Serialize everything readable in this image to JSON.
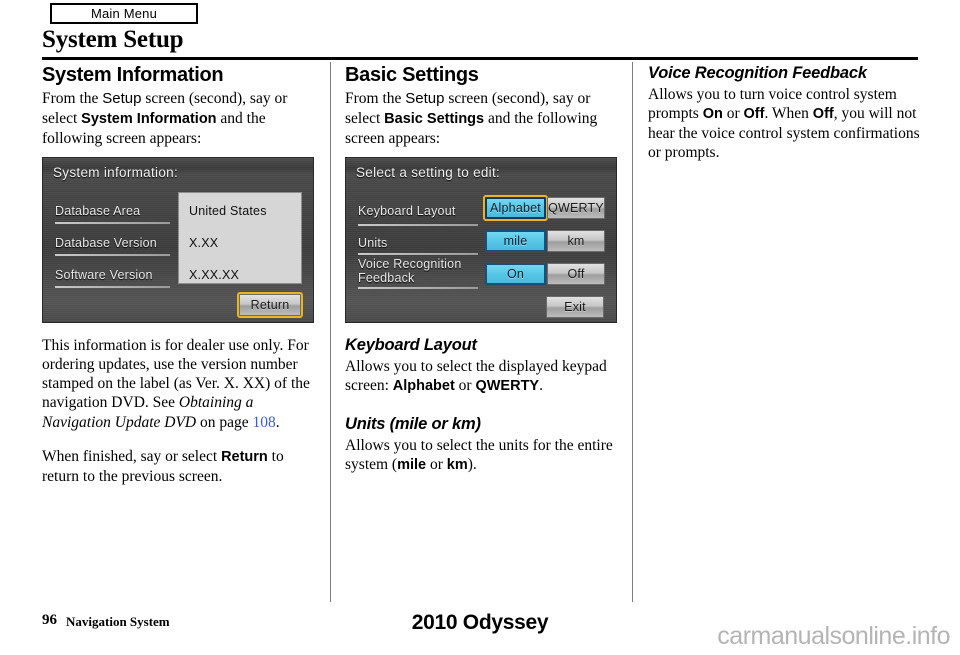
{
  "header": {
    "main_menu_tab": "Main Menu",
    "page_title": "System Setup"
  },
  "left_column": {
    "heading": "System Information",
    "intro_p1": "From the ",
    "intro_setup": "Setup",
    "intro_p2": " screen (second), say or select ",
    "intro_bold": "System Information",
    "intro_p3": " and the following screen appears:",
    "screen": {
      "title": "System information:",
      "rows": [
        {
          "label": "Database Area",
          "value": "United States"
        },
        {
          "label": "Database Version",
          "value": "X.XX"
        },
        {
          "label": "Software Version",
          "value": "X.XX.XX"
        }
      ],
      "return_button": "Return"
    },
    "caption_p1": "This information is for dealer use only. For ordering updates, use the version number stamped on the label (as Ver. X. XX) of the navigation DVD. See ",
    "caption_italic": "Obtaining a Navigation Update DVD",
    "caption_p2": " on page ",
    "caption_page": "108",
    "caption_p3": ".",
    "finish_p1": "When finished, say or select ",
    "finish_bold": "Return",
    "finish_p2": " to return to the previous screen."
  },
  "mid_column": {
    "heading": "Basic Settings",
    "intro_p1": "From the ",
    "intro_setup": "Setup",
    "intro_p2": " screen (second), say or select ",
    "intro_bold": "Basic Settings",
    "intro_p3": " and the following screen appears:",
    "screen": {
      "title": "Select a setting to edit:",
      "rows": [
        {
          "label": "Keyboard Layout",
          "options": [
            "Alphabet",
            "QWERTY"
          ],
          "selected": "Alphabet",
          "focused": "Alphabet"
        },
        {
          "label": "Units",
          "options": [
            "mile",
            "km"
          ],
          "selected": "mile",
          "focused": ""
        },
        {
          "label": "Voice Recognition Feedback",
          "options": [
            "On",
            "Off"
          ],
          "selected": "On",
          "focused": ""
        }
      ],
      "exit_button": "Exit"
    },
    "sub1_heading": "Keyboard Layout",
    "sub1_p1": "Allows you to select the displayed keypad screen: ",
    "sub1_b1": "Alphabet",
    "sub1_p2": " or ",
    "sub1_b2": "QWERTY",
    "sub1_p3": ".",
    "sub2_heading": "Units (mile or km)",
    "sub2_p1": "Allows you to select the units for the entire system (",
    "sub2_b1": "mile",
    "sub2_p2": " or ",
    "sub2_b2": "km",
    "sub2_p3": ")."
  },
  "right_column": {
    "heading": "Voice Recognition Feedback",
    "p1": "Allows you to turn voice control system prompts ",
    "b1": "On",
    "p2": " or ",
    "b2": "Off",
    "p3": ". When ",
    "b3": "Off",
    "p4": ", you will not hear the voice control system confirmations or prompts."
  },
  "footer": {
    "page_number": "96",
    "section_name": "Navigation System",
    "model": "2010 Odyssey",
    "watermark": "carmanualsonline.info"
  },
  "colors": {
    "page_link": "#3b5fc0",
    "selected_button": "#57c6e6",
    "focus_outline": "#f0b21e",
    "screen_bg": "#434343",
    "value_panel": "#d6d6d6"
  }
}
